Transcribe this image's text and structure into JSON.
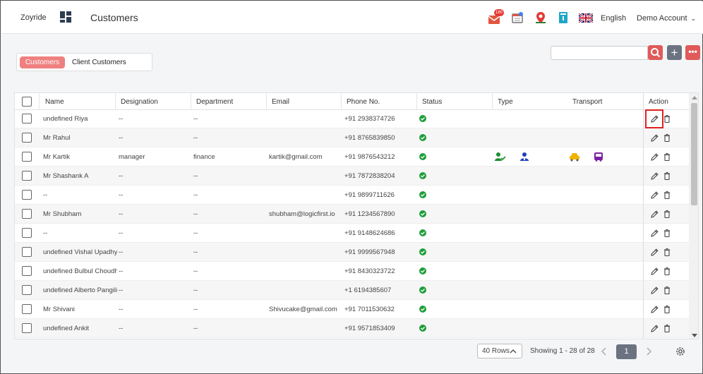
{
  "header": {
    "brand": "Zoyride",
    "page_title": "Customers",
    "notification_count": "180",
    "language": "English",
    "account": "Demo Account"
  },
  "tabs": {
    "active": "Customers",
    "other": "Client Customers"
  },
  "search": {
    "placeholder": ""
  },
  "table": {
    "columns": [
      "Name",
      "Designation",
      "Department",
      "Email",
      "Phone No.",
      "Status",
      "Type",
      "Transport",
      "Action"
    ],
    "rows": [
      {
        "name": "undefined Riya",
        "designation": "--",
        "department": "--",
        "email": "",
        "phone": "+91 2938374726"
      },
      {
        "name": "Mr Rahul",
        "designation": "--",
        "department": "--",
        "email": "",
        "phone": "+91 8765839850"
      },
      {
        "name": "Mr Kartik",
        "designation": "manager",
        "department": "finance",
        "email": "kartik@gmail.com",
        "phone": "+91 9876543212"
      },
      {
        "name": "Mr Shashank A",
        "designation": "--",
        "department": "--",
        "email": "",
        "phone": "+91 7872838204"
      },
      {
        "name": "--",
        "designation": "--",
        "department": "--",
        "email": "",
        "phone": "+91 9899711626"
      },
      {
        "name": "Mr Shubham",
        "designation": "--",
        "department": "--",
        "email": "shubham@logicfirst.io",
        "phone": "+91 1234567890"
      },
      {
        "name": "--",
        "designation": "--",
        "department": "--",
        "email": "",
        "phone": "+91 9148624686"
      },
      {
        "name": "undefined Vishal Upadhya",
        "designation": "--",
        "department": "--",
        "email": "",
        "phone": "+91 9999567948"
      },
      {
        "name": "undefined Bulbul Choudh",
        "designation": "--",
        "department": "--",
        "email": "",
        "phone": "+91 8430323722"
      },
      {
        "name": "undefined Alberto Pangilir",
        "designation": "--",
        "department": "--",
        "email": "",
        "phone": "+1 6194385607"
      },
      {
        "name": "Mr Shivani",
        "designation": "--",
        "department": "--",
        "email": "Shivucake@gmail.com",
        "phone": "+91 7011530632"
      },
      {
        "name": "undefined Ankit",
        "designation": "--",
        "department": "--",
        "email": "",
        "phone": "+91 9571853409"
      }
    ]
  },
  "footer": {
    "rows_select": "40 Rows",
    "showing": "Showing  1 - 28 of 28",
    "current_page": "1"
  },
  "colors": {
    "accent": "#f08080",
    "status_ok": "#1e9e3a",
    "edit_highlight": "#e02020"
  }
}
